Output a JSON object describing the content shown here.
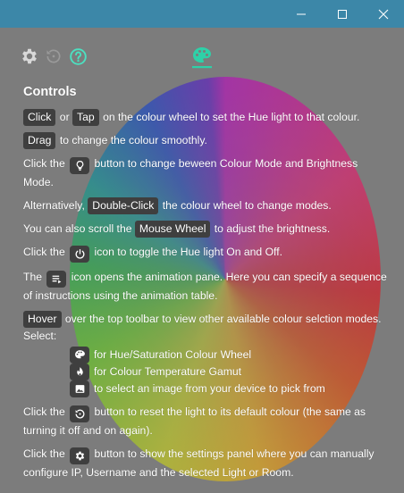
{
  "window": {
    "controls": [
      "minimize-icon",
      "maximize-icon",
      "close-icon"
    ],
    "title_bar_color": "#3c87a8"
  },
  "toolbar": {
    "icons": [
      "gear-icon",
      "history-icon",
      "help-icon",
      "palette-icon"
    ],
    "help_color": "#4ce0c0",
    "palette_color": "#2ed1a8"
  },
  "help": {
    "heading": "Controls",
    "p1": {
      "k1": "Click",
      "t1": "or",
      "k2": "Tap",
      "t2": "on the colour wheel to set the Hue light to that colour."
    },
    "p2": {
      "k1": "Drag",
      "t1": "to change the colour smoothly."
    },
    "p3": {
      "t1": "Click the",
      "t2": "button to change beween Colour Mode and Brightness Mode."
    },
    "p4": {
      "t1": "Alternatively,",
      "k1": "Double-Click",
      "t2": "the colour wheel to change modes."
    },
    "p5": {
      "t1": "You can also scroll the",
      "k1": "Mouse Wheel",
      "t2": "to adjust the brightness."
    },
    "p6": {
      "t1": "Click the",
      "t2": "icon to toggle the Hue light On and Off."
    },
    "p7": {
      "t1": "The",
      "t2": "icon opens the animation pane. Here you can specify a sequence of instructions using the animation table."
    },
    "p8": {
      "k1": "Hover",
      "t1": "over the top toolbar to view other available colour selction modes. Select:"
    },
    "sub": [
      {
        "icon": "palette-icon",
        "text": "for Hue/Saturation Colour Wheel"
      },
      {
        "icon": "flame-icon",
        "text": "for Colour Temperature Gamut"
      },
      {
        "icon": "image-icon",
        "text": "to select an image from your device to pick from"
      }
    ],
    "p9": {
      "t1": "Click the",
      "t2": "button to reset the light to its default colour (the same as turning it off and on again)."
    },
    "p10": {
      "t1": "Click the",
      "t2": "button to show the settings panel where you can manually configure IP, Username and the selected Light or Room."
    }
  }
}
